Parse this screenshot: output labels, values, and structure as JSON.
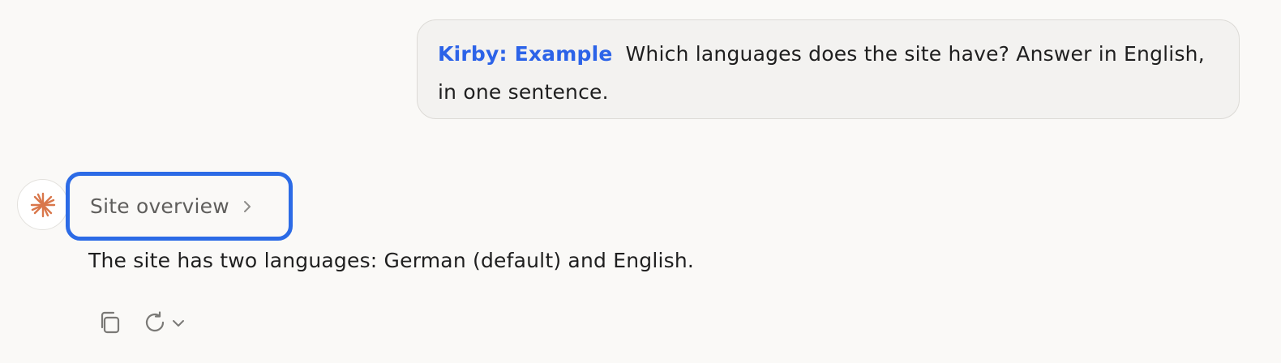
{
  "user_message": {
    "context_tag": "Kirby: Example",
    "text": "Which languages does the site have? Answer in English, in one sentence."
  },
  "assistant": {
    "avatar_icon": "asterisk-sparkle-icon",
    "tool_pill": {
      "label": "Site overview",
      "icon": "chevron-right-icon"
    },
    "answer_text": "The site has two languages: German (default) and English.",
    "actions": {
      "copy_icon": "copy-icon",
      "retry_icon": "retry-icon",
      "retry_menu_icon": "chevron-down-icon"
    }
  },
  "colors": {
    "accent_blue": "#2c6be6",
    "tag_blue": "#2c63e8",
    "avatar_orange": "#d9774b",
    "background": "#faf9f7"
  }
}
